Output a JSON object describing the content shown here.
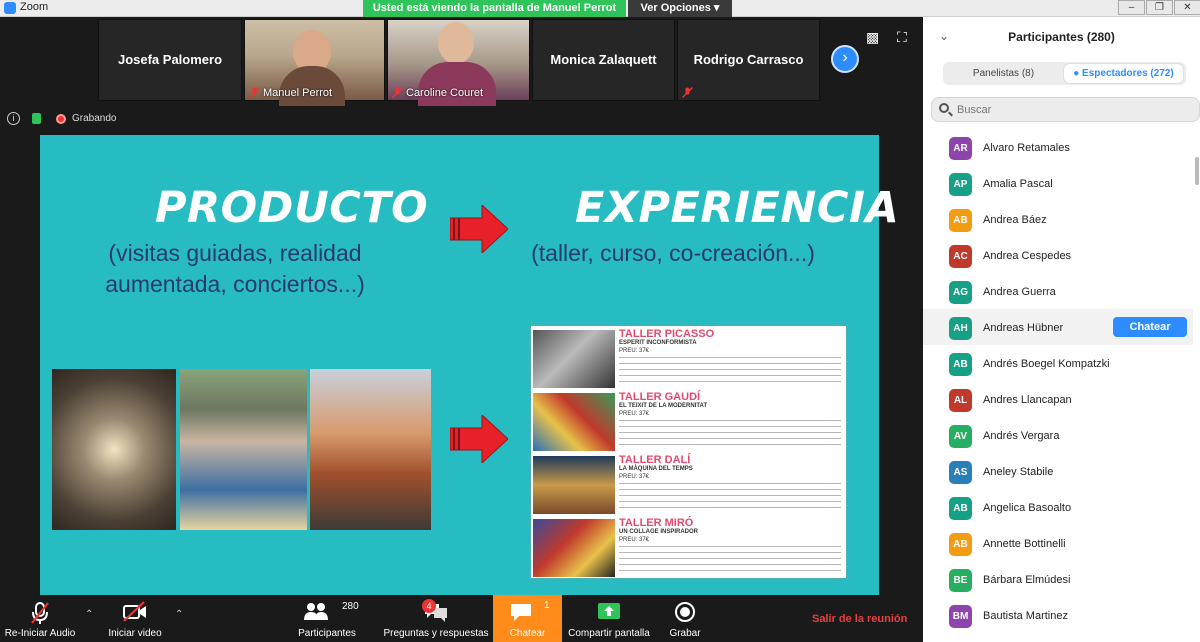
{
  "window": {
    "title": "Zoom",
    "share_banner": "Usted está viendo la pantalla de Manuel Perrot",
    "view_options": "Ver Opciones"
  },
  "gallery": {
    "tiles": [
      {
        "name": "Josefa Palomero",
        "has_video": false
      },
      {
        "name": "Manuel Perrot",
        "has_video": true
      },
      {
        "name": "Caroline Couret",
        "has_video": true
      },
      {
        "name": "Monica Zalaquett",
        "has_video": false
      },
      {
        "name": "Rodrigo Carrasco",
        "has_video": false
      }
    ]
  },
  "status": {
    "recording_label": "Grabando"
  },
  "slide": {
    "left_title": "PRODUCTO",
    "left_sub_1": "(visitas guiadas, realidad",
    "left_sub_2": "aumentada, conciertos...)",
    "right_title": "EXPERIENCIA",
    "right_sub": "(taller, curso, co-creación...)",
    "arrow_color": "#e8202a",
    "brochure": [
      {
        "title": "TALLER PICASSO",
        "subtitle": "ESPERIT INCONFORMISTA",
        "price": "PREU: 37€"
      },
      {
        "title": "TALLER GAUDÍ",
        "subtitle": "EL TEIXIT DE LA MODERNITAT",
        "price": "PREU: 37€"
      },
      {
        "title": "TALLER DALÍ",
        "subtitle": "LA MÀQUINA DEL TEMPS",
        "price": "PREU: 37€"
      },
      {
        "title": "TALLER MIRÓ",
        "subtitle": "UN COLLAGE INSPIRADOR",
        "price": "PREU: 37€"
      }
    ]
  },
  "toolbar": {
    "audio": "Re-Iniciar Audio",
    "video": "Iniciar video",
    "participants": "Participantes",
    "participants_count": "280",
    "qa": "Preguntas y respuestas",
    "qa_badge": "4",
    "chat": "Chatear",
    "chat_badge": "1",
    "share": "Compartir pantalla",
    "record": "Grabar",
    "leave": "Salir de la reunión"
  },
  "panel": {
    "title": "Participantes (280)",
    "tab_panelists": "Panelistas (8)",
    "tab_viewers": "Espectadores (272)",
    "search_placeholder": "Buscar",
    "chat_button": "Chatear",
    "participants": [
      {
        "initials": "AR",
        "name": "Alvaro Retamales",
        "color": "#8e44ad"
      },
      {
        "initials": "AP",
        "name": "Amalia Pascal",
        "color": "#16a085"
      },
      {
        "initials": "AB",
        "name": "Andrea Báez",
        "color": "#f39c12"
      },
      {
        "initials": "AC",
        "name": "Andrea Cespedes",
        "color": "#c0392b"
      },
      {
        "initials": "AG",
        "name": "Andrea Guerra",
        "color": "#16a085"
      },
      {
        "initials": "AH",
        "name": "Andreas Hübner",
        "color": "#16a085"
      },
      {
        "initials": "AB",
        "name": "Andrés Boegel Kompatzki",
        "color": "#16a085"
      },
      {
        "initials": "AL",
        "name": "Andres Llancapan",
        "color": "#c0392b"
      },
      {
        "initials": "AV",
        "name": "Andrés Vergara",
        "color": "#27ae60"
      },
      {
        "initials": "AS",
        "name": "Aneley Stabile",
        "color": "#2980b9"
      },
      {
        "initials": "AB",
        "name": "Angelica Basoalto",
        "color": "#16a085"
      },
      {
        "initials": "AB",
        "name": "Annette Bottinelli",
        "color": "#f39c12"
      },
      {
        "initials": "BE",
        "name": "Bárbara Elmúdesi",
        "color": "#27ae60"
      },
      {
        "initials": "BM",
        "name": "Bautista Martinez",
        "color": "#8e44ad"
      }
    ]
  }
}
